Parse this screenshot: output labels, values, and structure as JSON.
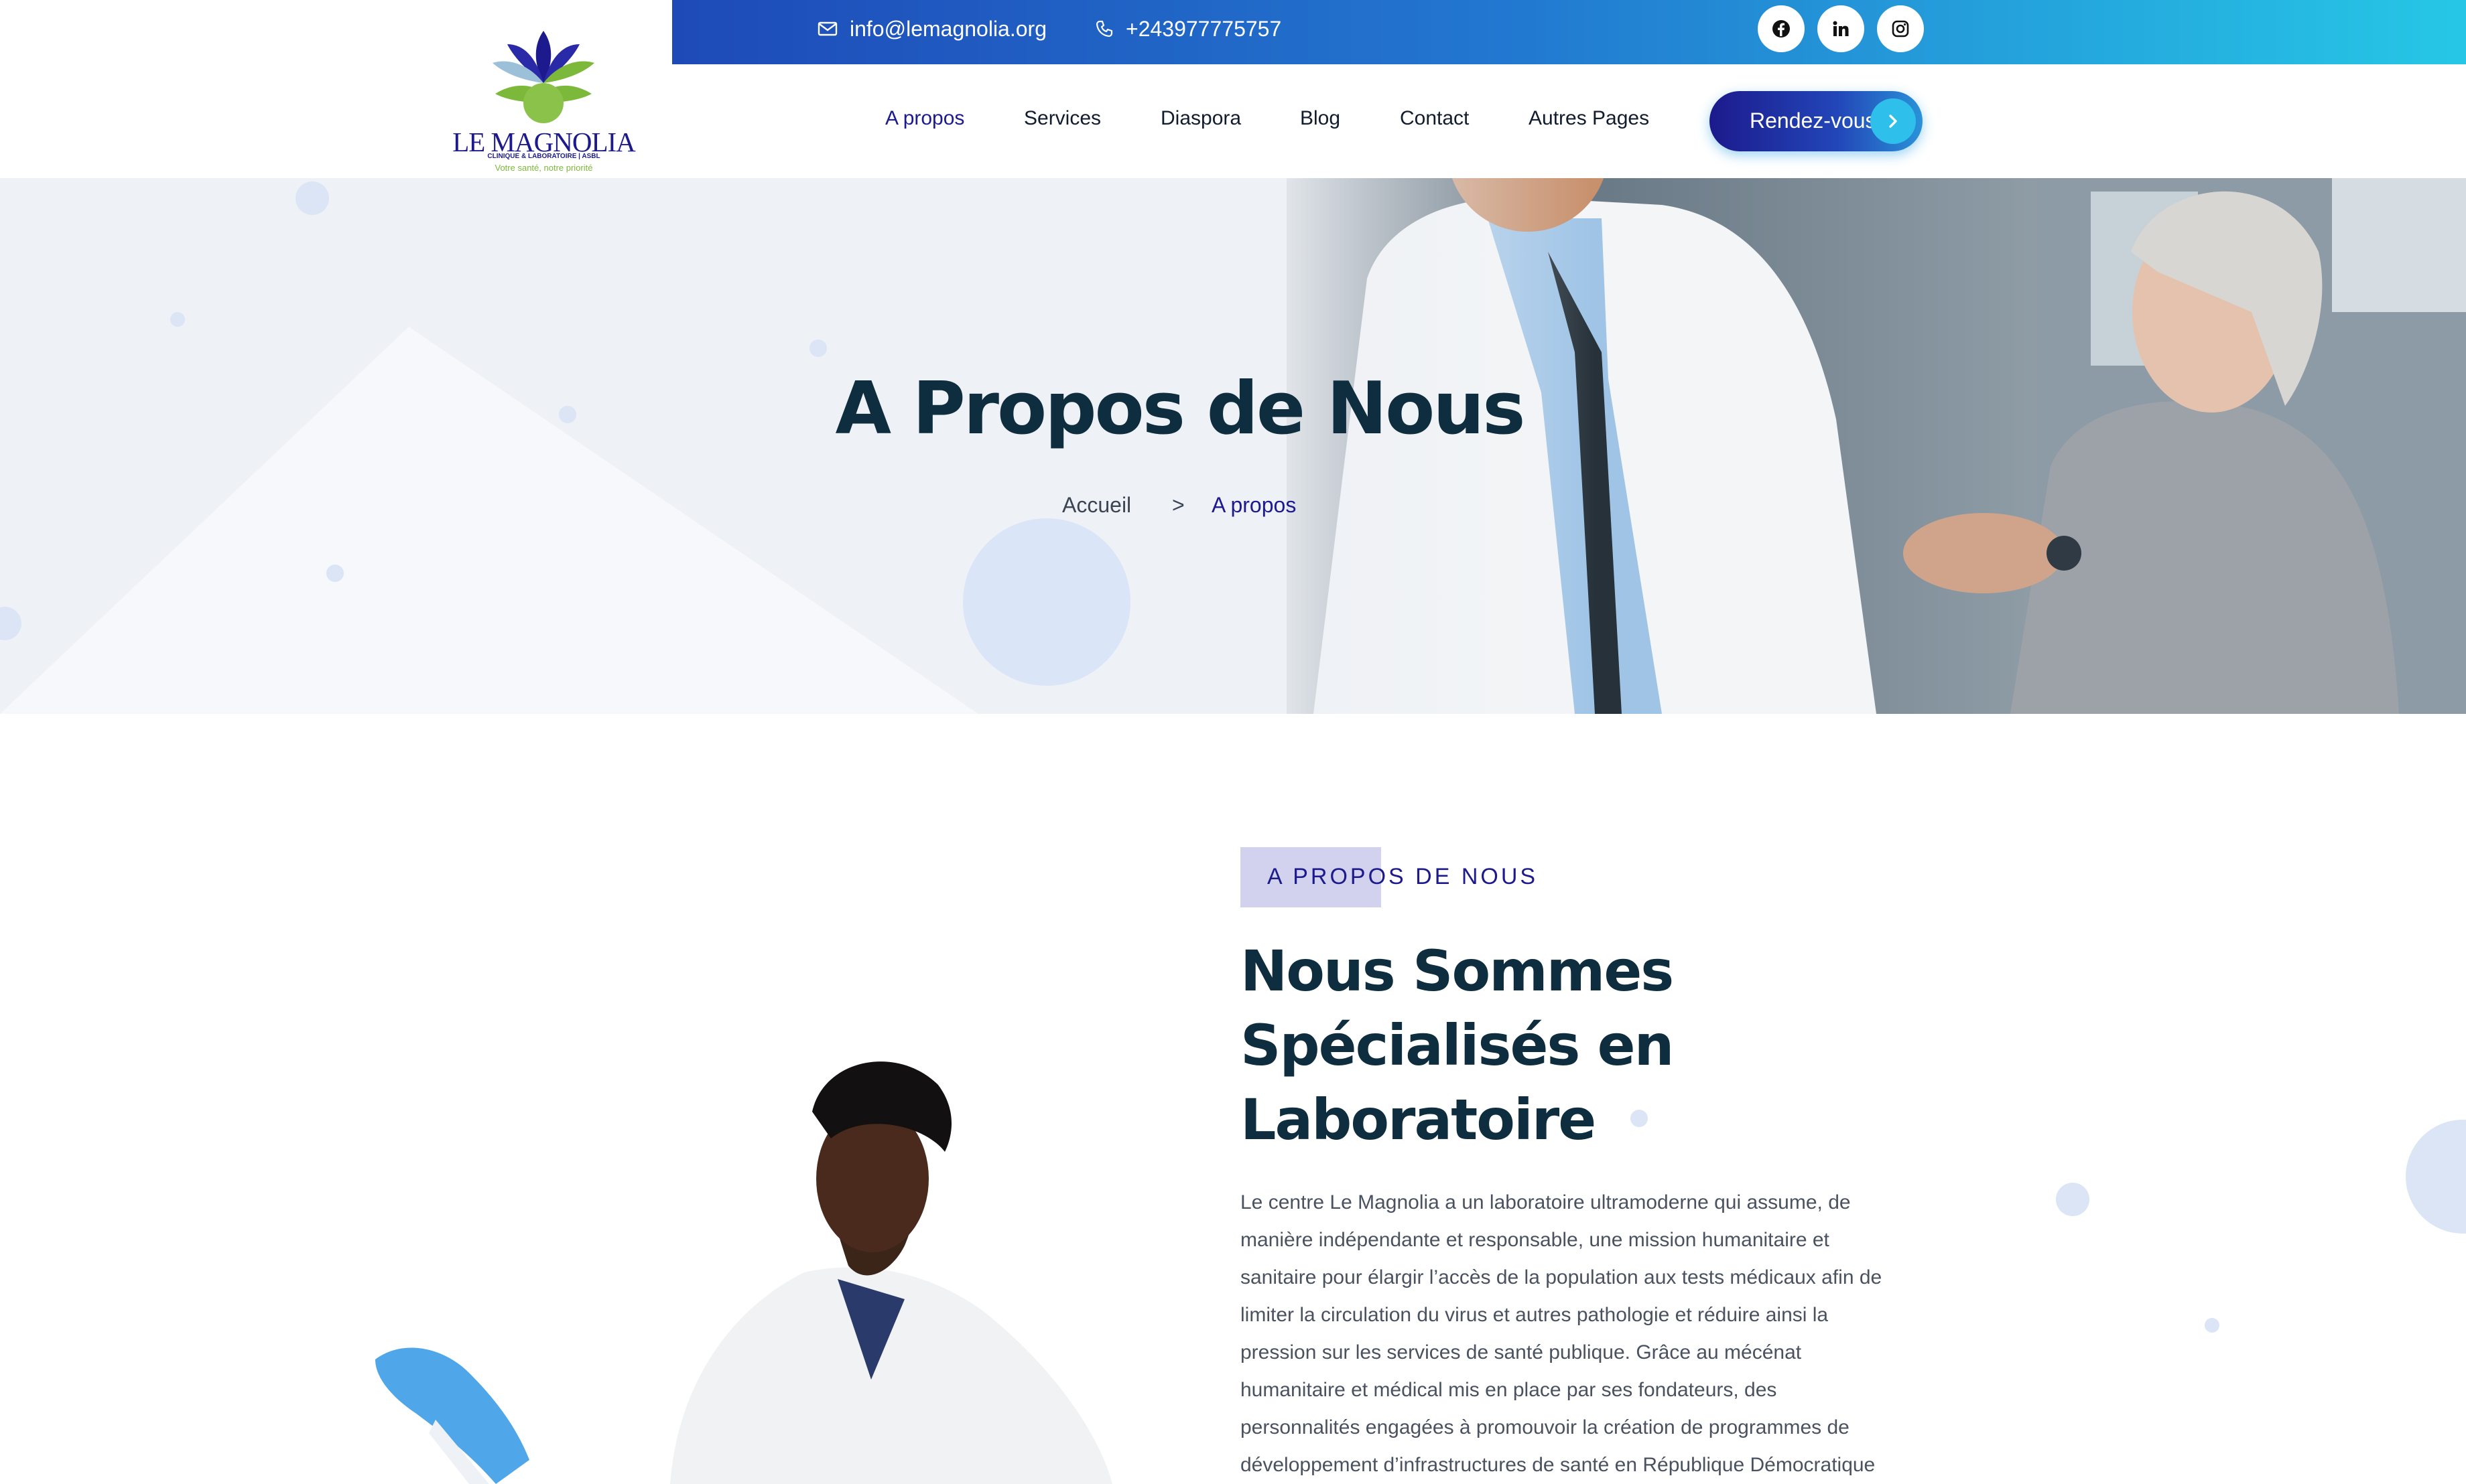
{
  "topbar": {
    "email": "info@lemagnolia.org",
    "phone": "+243977775757",
    "social_icons": [
      "facebook-icon",
      "linkedin-icon",
      "instagram-icon"
    ]
  },
  "logo": {
    "name": "LE MAGNOLIA",
    "subtitle": "CLINIQUE & LABORATOIRE | ASBL",
    "tagline": "Votre santé, notre priorité"
  },
  "nav": {
    "items": [
      {
        "label": "A propos",
        "active": true
      },
      {
        "label": "Services",
        "active": false
      },
      {
        "label": "Diaspora",
        "active": false
      },
      {
        "label": "Blog",
        "active": false
      },
      {
        "label": "Contact",
        "active": false
      },
      {
        "label": "Autres Pages",
        "active": false
      }
    ],
    "cta_label": "Rendez-vous"
  },
  "hero": {
    "title": "A Propos de Nous",
    "breadcrumb": {
      "home": "Accueil",
      "separator": ">",
      "current": "A propos"
    }
  },
  "about": {
    "tag": "A PROPOS DE NOUS",
    "title_lines": [
      "Nous Sommes",
      "Spécialisés en",
      "Laboratoire"
    ],
    "paragraph_lines": [
      "Le centre Le Magnolia a un laboratoire ultramoderne qui assume, de",
      "manière indépendante et responsable, une mission humanitaire et",
      "sanitaire pour élargir l’accès de la population aux tests médicaux afin de",
      "limiter la circulation du virus et autres pathologie et réduire ainsi la",
      "pression sur les services de santé publique. Grâce au mécénat",
      "humanitaire et médical mis en place par ses fondateurs, des",
      "personnalités engagées à promouvoir la création de programmes de",
      "développement d’infrastructures de santé en République Démocratique"
    ]
  },
  "colors": {
    "brand_navy": "#1c1a8c",
    "heading": "#0e2d3e",
    "gradient_start": "#1e4ab8",
    "gradient_end": "#26c7e6",
    "logo_green": "#7cb93a"
  }
}
